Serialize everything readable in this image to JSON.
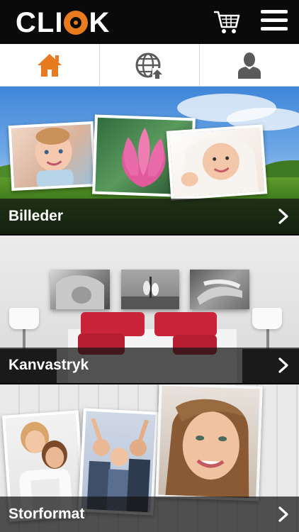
{
  "header": {
    "logo_text_left": "CLI",
    "logo_text_right": "K",
    "cart_icon": "shopping-cart-icon",
    "menu_icon": "hamburger-menu-icon"
  },
  "tabs": [
    {
      "icon": "home-icon",
      "active": true
    },
    {
      "icon": "globe-upload-icon",
      "active": false
    },
    {
      "icon": "user-icon",
      "active": false
    }
  ],
  "sections": [
    {
      "label": "Billeder"
    },
    {
      "label": "Kanvastryk"
    },
    {
      "label": "Storformat"
    }
  ],
  "colors": {
    "accent": "#e87a1f",
    "header_bg": "#0a0a0a",
    "icon_gray": "#5a5a5a"
  }
}
